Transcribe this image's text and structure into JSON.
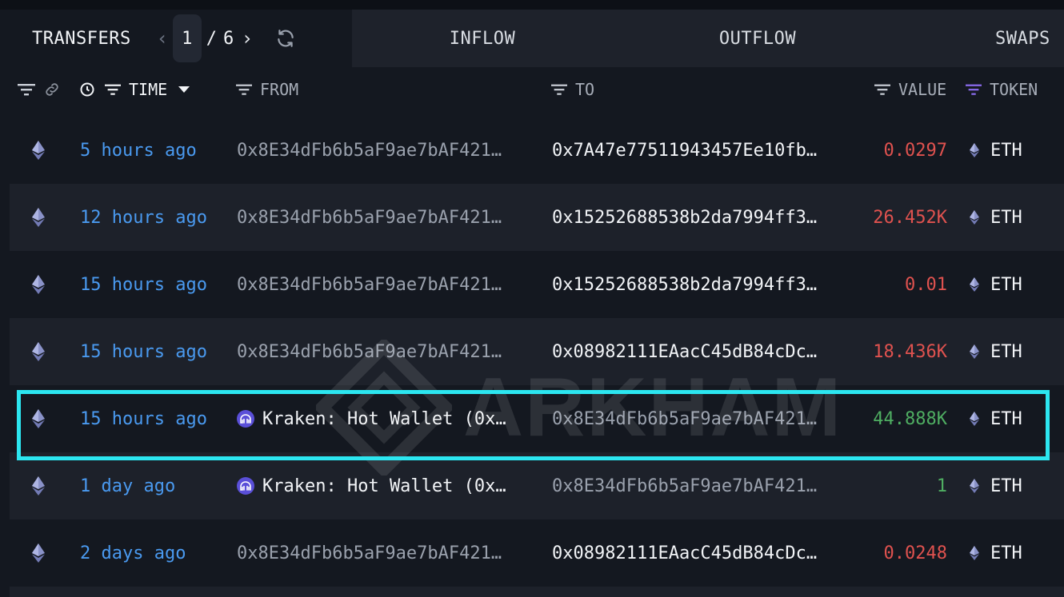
{
  "tabs": {
    "transfers_label": "TRANSFERS",
    "inflow_label": "INFLOW",
    "outflow_label": "OUTFLOW",
    "swaps_label": "SWAPS"
  },
  "pager": {
    "current": "1",
    "separator": "/",
    "total": "6"
  },
  "headers": {
    "time": "TIME",
    "from": "FROM",
    "to": "TO",
    "value": "VALUE",
    "token": "TOKEN"
  },
  "watermark": "ARKHAM",
  "colors": {
    "accent_blue": "#4a9af0",
    "value_red": "#e0524f",
    "value_green": "#4fae62",
    "highlight": "#2ce6f0",
    "kraken": "#5a4fd8"
  },
  "rows": [
    {
      "time": "5 hours ago",
      "from": "0x8E34dFb6b5aF9ae7bAF421…",
      "to": "0x7A47e77511943457Ee10fb…",
      "value": "0.0297",
      "token": "ETH"
    },
    {
      "time": "12 hours ago",
      "from": "0x8E34dFb6b5aF9ae7bAF421…",
      "to": "0x15252688538b2da7994ff3…",
      "value": "26.452K",
      "token": "ETH"
    },
    {
      "time": "15 hours ago",
      "from": "0x8E34dFb6b5aF9ae7bAF421…",
      "to": "0x15252688538b2da7994ff3…",
      "value": "0.01",
      "token": "ETH"
    },
    {
      "time": "15 hours ago",
      "from": "0x8E34dFb6b5aF9ae7bAF421…",
      "to": "0x08982111EAacC45dB84cDc…",
      "value": "18.436K",
      "token": "ETH"
    },
    {
      "time": "15 hours ago",
      "from": "Kraken: Hot Wallet (0x…",
      "to": "0x8E34dFb6b5aF9ae7bAF421…",
      "value": "44.888K",
      "token": "ETH"
    },
    {
      "time": "1 day ago",
      "from": "Kraken: Hot Wallet (0x…",
      "to": "0x8E34dFb6b5aF9ae7bAF421…",
      "value": "1",
      "token": "ETH"
    },
    {
      "time": "2 days ago",
      "from": "0x8E34dFb6b5aF9ae7bAF421…",
      "to": "0x08982111EAacC45dB84cDc…",
      "value": "0.0248",
      "token": "ETH"
    }
  ]
}
